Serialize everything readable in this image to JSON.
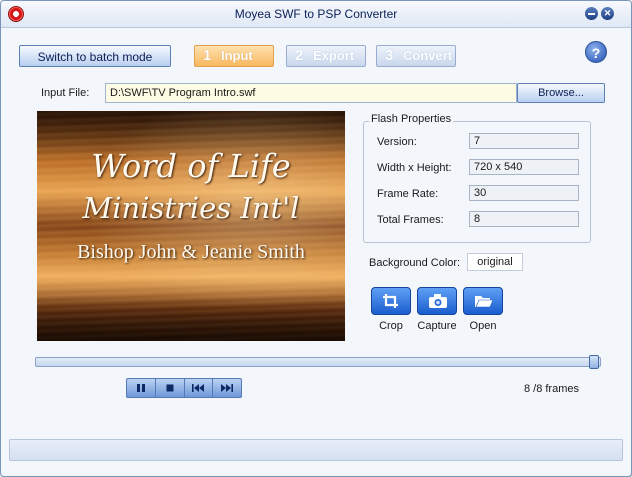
{
  "window": {
    "title": "Moyea SWF to PSP Converter"
  },
  "toolbar": {
    "batch_label": "Switch to batch mode",
    "steps": [
      {
        "num": "1",
        "label": "Input"
      },
      {
        "num": "2",
        "label": "Export"
      },
      {
        "num": "3",
        "label": "Convert"
      }
    ],
    "help_label": "?"
  },
  "input": {
    "label": "Input File:",
    "value": "D:\\SWF\\TV Program Intro.swf",
    "browse_label": "Browse..."
  },
  "preview": {
    "line1": "Word of Life",
    "line2": "Ministries Int'l",
    "line3": "Bishop John & Jeanie Smith"
  },
  "flash_properties": {
    "title": "Flash Properties",
    "rows": [
      {
        "label": "Version:",
        "value": "7"
      },
      {
        "label": "Width x Height:",
        "value": "720 x 540"
      },
      {
        "label": "Frame Rate:",
        "value": "30"
      },
      {
        "label": "Total Frames:",
        "value": "8"
      }
    ]
  },
  "background": {
    "label": "Background Color:",
    "value": "original"
  },
  "tools": [
    {
      "label": "Crop",
      "icon": "crop-icon"
    },
    {
      "label": "Capture",
      "icon": "camera-icon"
    },
    {
      "label": "Open",
      "icon": "folder-open-icon"
    }
  ],
  "playback": {
    "progress": 1.0,
    "frames_text": "8 /8 frames",
    "buttons": [
      "pause-icon",
      "stop-icon",
      "rewind-icon",
      "fast-forward-icon"
    ]
  },
  "colors": {
    "accent": "#1a5dcd",
    "active_step": "#f8b860",
    "input_bg": "#fdfbe3"
  }
}
